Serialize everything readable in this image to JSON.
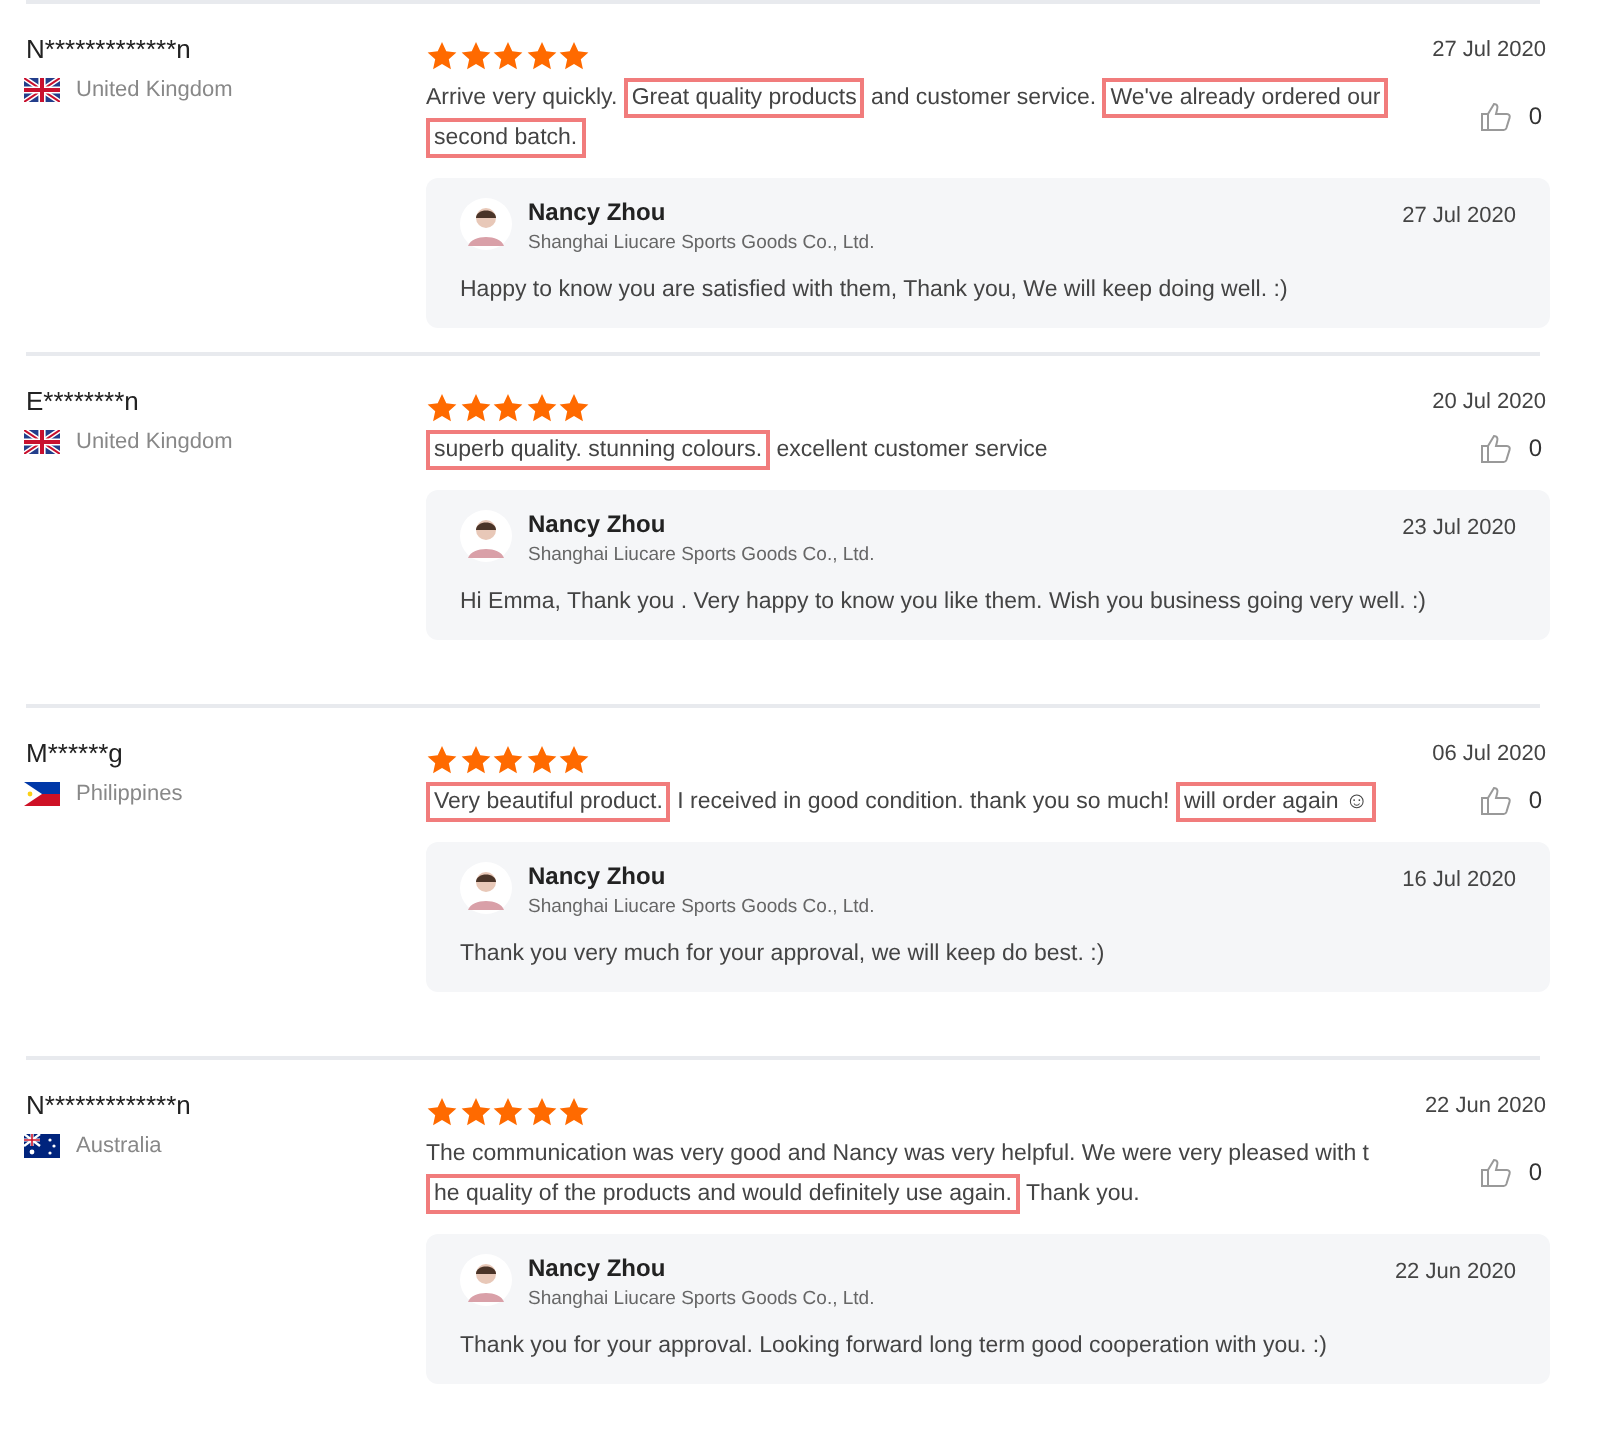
{
  "reviews": [
    {
      "reviewer": "N*************n",
      "country": "United Kingdom",
      "kind": "uk",
      "stars": 5,
      "date": "27 Jul 2020",
      "likes": "0",
      "text": [
        {
          "text": "Arrive very quickly. ",
          "highlighted": false
        },
        {
          "text": "Great quality products",
          "highlighted": true
        },
        {
          "text": " and customer service. ",
          "highlighted": false
        },
        {
          "text": "We've already ordered our\nsecond batch.",
          "highlighted": true
        }
      ],
      "reply": {
        "name": "Nancy Zhou",
        "company": "Shanghai Liucare Sports Goods Co., Ltd.",
        "date": "27 Jul 2020",
        "text": "Happy to know you are satisfied with them, Thank you, We will keep doing well.  :)"
      }
    },
    {
      "reviewer": "E********n",
      "country": "United Kingdom",
      "kind": "uk",
      "stars": 5,
      "date": "20 Jul 2020",
      "likes": "0",
      "text": [
        {
          "text": "superb quality. stunning colours.",
          "highlighted": true
        },
        {
          "text": " excellent customer service",
          "highlighted": false
        }
      ],
      "reply": {
        "name": "Nancy Zhou",
        "company": "Shanghai Liucare Sports Goods Co., Ltd.",
        "date": "23 Jul 2020",
        "text": "Hi Emma, Thank you . Very happy to know you like them. Wish you business going very well. :)"
      }
    },
    {
      "reviewer": "M******g",
      "country": "Philippines",
      "kind": "ph",
      "stars": 5,
      "date": "06 Jul 2020",
      "likes": "0",
      "text": [
        {
          "text": "Very beautiful product.",
          "highlighted": true
        },
        {
          "text": " I received in good condition. thank you so much! ",
          "highlighted": false
        },
        {
          "text": "will order again ☺",
          "highlighted": true
        }
      ],
      "reply": {
        "name": "Nancy Zhou",
        "company": "Shanghai Liucare Sports Goods Co., Ltd.",
        "date": "16 Jul 2020",
        "text": "Thank you very much for your approval, we will keep do best. :)"
      }
    },
    {
      "reviewer": "N*************n",
      "country": "Australia",
      "kind": "au",
      "stars": 5,
      "date": "22 Jun 2020",
      "likes": "0",
      "text": [
        {
          "text": "The communication was very good and Nancy was very helpful. We were very pleased with t\n",
          "highlighted": false
        },
        {
          "text": "he quality of the products and would definitely use again.",
          "highlighted": true
        },
        {
          "text": " Thank you.",
          "highlighted": false
        }
      ],
      "reply": {
        "name": "Nancy Zhou",
        "company": "Shanghai Liucare Sports Goods Co., Ltd.",
        "date": "22 Jun 2020",
        "text": "Thank you for your approval. Looking forward long term good cooperation with you. :)"
      }
    }
  ]
}
